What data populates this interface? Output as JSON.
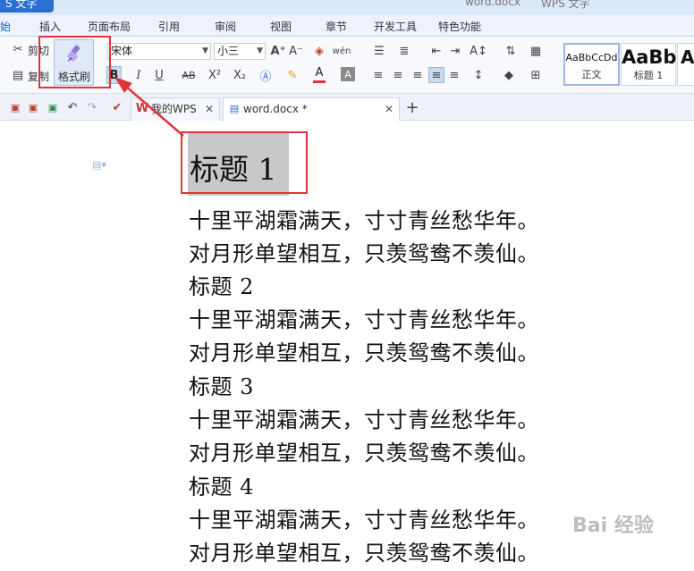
{
  "titlebar": {
    "app_label": "S 文字",
    "doc_title": "word.docx",
    "app_title": "WPS 文字"
  },
  "ribbon_tabs": [
    {
      "label": "始"
    },
    {
      "label": "插入"
    },
    {
      "label": "页面布局"
    },
    {
      "label": "引用"
    },
    {
      "label": "审阅"
    },
    {
      "label": "视图"
    },
    {
      "label": "章节"
    },
    {
      "label": "开发工具"
    },
    {
      "label": "特色功能"
    }
  ],
  "clipboard": {
    "cut_label": "剪切",
    "copy_label": "复制",
    "format_painter_label": "格式刷"
  },
  "font": {
    "name": "宋体",
    "size": "小三",
    "bold": "B",
    "italic": "I",
    "underline": "U",
    "strike": "AB",
    "superscript": "X²",
    "subscript": "X₂",
    "font_color": "A"
  },
  "styles": [
    {
      "sample": "AaBbCcDd",
      "name": "正文"
    },
    {
      "sample": "AaBb",
      "name": "标题 1"
    },
    {
      "sample": "A",
      "name": ""
    }
  ],
  "doc_tabs": [
    {
      "label": "我的WPS"
    },
    {
      "label": "word.docx *"
    }
  ],
  "document": {
    "heading1": "标题 1",
    "lines": [
      "十里平湖霜满天，寸寸青丝愁华年。",
      "对月形单望相互，只羡鸳鸯不羡仙。",
      "标题 2",
      "十里平湖霜满天，寸寸青丝愁华年。",
      "对月形单望相互，只羡鸳鸯不羡仙。",
      "标题 3",
      "十里平湖霜满天，寸寸青丝愁华年。",
      "对月形单望相互，只羡鸳鸯不羡仙。",
      "标题 4",
      "十里平湖霜满天，寸寸青丝愁华年。",
      "对月形单望相互，只羡鸳鸯不羡仙。"
    ]
  },
  "watermark": "Bai 经验",
  "colors": {
    "accent": "#2a6fd1",
    "highlight_box": "#e0343a",
    "heading_bg": "#c8c8c8"
  }
}
